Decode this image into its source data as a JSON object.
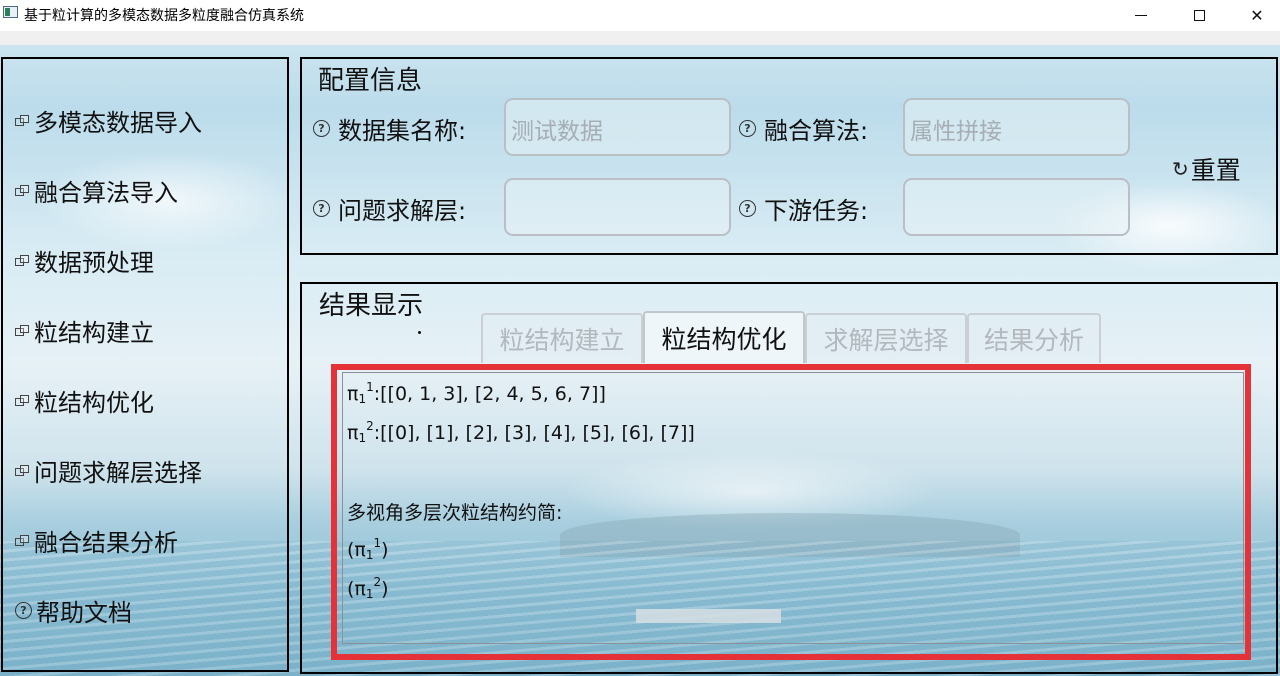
{
  "window": {
    "title": "基于粒计算的多模态数据多粒度融合仿真系统"
  },
  "sidebar": {
    "items": [
      {
        "label": "多模态数据导入",
        "icon": "restore-window-icon"
      },
      {
        "label": "融合算法导入",
        "icon": "restore-window-icon"
      },
      {
        "label": "数据预处理",
        "icon": "restore-window-icon"
      },
      {
        "label": "粒结构建立",
        "icon": "restore-window-icon"
      },
      {
        "label": "粒结构优化",
        "icon": "restore-window-icon"
      },
      {
        "label": "问题求解层选择",
        "icon": "restore-window-icon"
      },
      {
        "label": "融合结果分析",
        "icon": "restore-window-icon"
      },
      {
        "label": "帮助文档",
        "icon": "help-icon"
      }
    ]
  },
  "config": {
    "title": "配置信息",
    "dataset_label": "数据集名称:",
    "dataset_value": "测试数据",
    "algorithm_label": "融合算法:",
    "algorithm_value": "属性拼接",
    "layer_label": "问题求解层:",
    "layer_value": "",
    "task_label": "下游任务:",
    "task_value": "",
    "reset_label": "重置"
  },
  "results": {
    "title": "结果显示",
    "tabs": [
      {
        "label": "粒结构建立",
        "active": false
      },
      {
        "label": "粒结构优化",
        "active": true
      },
      {
        "label": "求解层选择",
        "active": false
      },
      {
        "label": "结果分析",
        "active": false
      }
    ],
    "lines": {
      "l1_pi": "π",
      "l1_sub": "1",
      "l1_sup": "1",
      "l1_text": ":[[0, 1, 3], [2, 4, 5, 6, 7]]",
      "l2_pi": "π",
      "l2_sub": "1",
      "l2_sup": "2",
      "l2_text": ":[[0], [1], [2], [3], [4], [5], [6], [7]]",
      "l3_text": "多视角多层次粒结构约简:",
      "l4_open": "(π",
      "l4_sub": "1",
      "l4_sup": "1",
      "l4_close": ")",
      "l5_open": "(π",
      "l5_sub": "1",
      "l5_sup": "2",
      "l5_close": ")"
    }
  },
  "colors": {
    "highlight": "#e53238",
    "frame": "#000000",
    "disabled_text": "#b2b8bd"
  }
}
